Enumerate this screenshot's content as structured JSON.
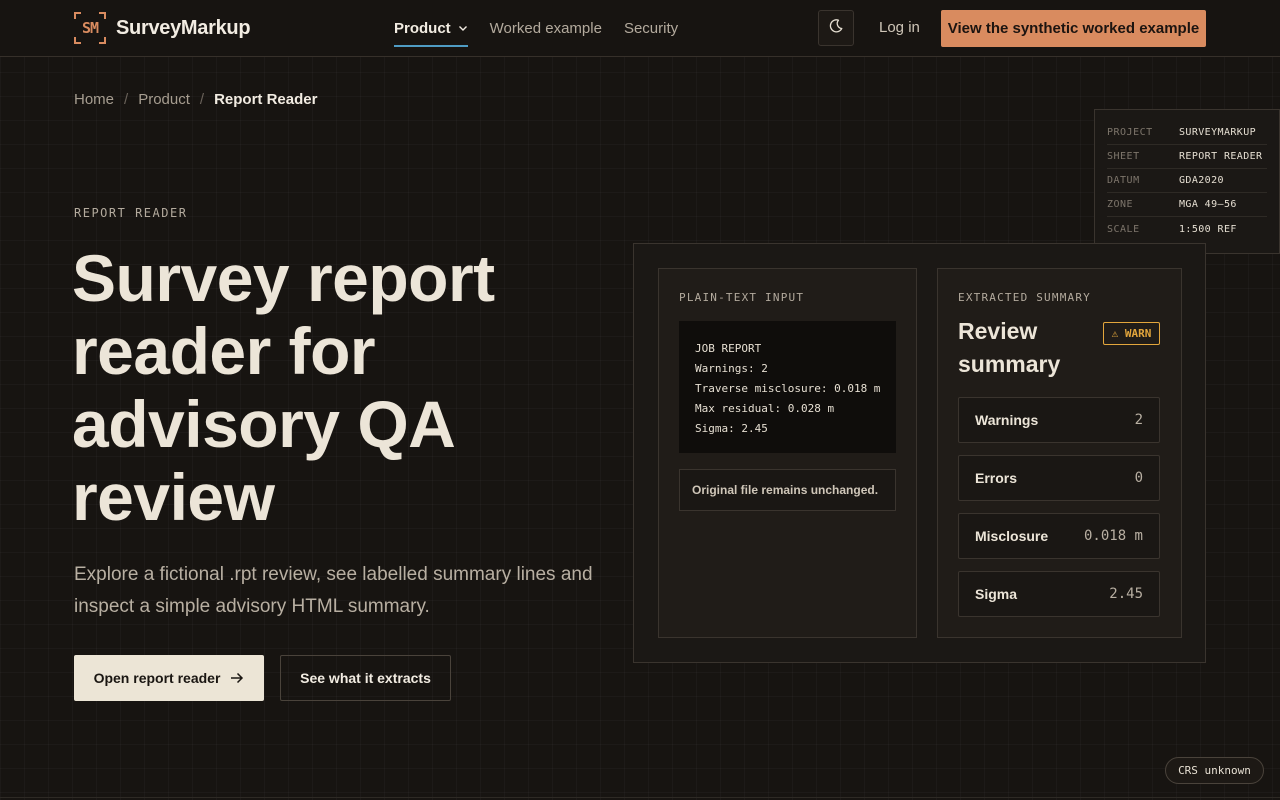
{
  "header": {
    "logo_initials": "SM",
    "brand": "SurveyMarkup",
    "nav": [
      {
        "label": "Product",
        "active": true
      },
      {
        "label": "Worked example",
        "active": false
      },
      {
        "label": "Security",
        "active": false
      }
    ],
    "theme_icon": "moon-icon",
    "login_label": "Log in",
    "cta_label": "View the synthetic worked example"
  },
  "breadcrumb": {
    "items": [
      "Home",
      "Product"
    ],
    "current": "Report Reader",
    "separator": "/"
  },
  "title_block": [
    {
      "key": "PROJECT",
      "value": "SURVEYMARKUP"
    },
    {
      "key": "SHEET",
      "value": "REPORT READER"
    },
    {
      "key": "DATUM",
      "value": "GDA2020"
    },
    {
      "key": "ZONE",
      "value": "MGA 49–56"
    },
    {
      "key": "SCALE",
      "value": "1:500 REF"
    }
  ],
  "hero": {
    "eyebrow": "REPORT READER",
    "title": "Survey report reader for advisory QA review",
    "description": "Explore a fictional .rpt review, see labelled summary lines and inspect a simple advisory HTML summary.",
    "primary_button": "Open report reader",
    "secondary_button": "See what it extracts"
  },
  "demo": {
    "input_label": "PLAIN-TEXT INPUT",
    "input_lines": [
      "JOB REPORT",
      "Warnings: 2",
      "Traverse misclosure: 0.018 m",
      "Max residual: 0.028 m",
      "Sigma: 2.45"
    ],
    "note": "Original file remains unchanged.",
    "summary_label": "EXTRACTED SUMMARY",
    "summary_title": "Review summary",
    "badge": "⚠ WARN",
    "metrics": [
      {
        "label": "Warnings",
        "value": "2"
      },
      {
        "label": "Errors",
        "value": "0"
      },
      {
        "label": "Misclosure",
        "value": "0.018 m"
      },
      {
        "label": "Sigma",
        "value": "2.45"
      }
    ]
  },
  "crs_chip": "CRS unknown",
  "colors": {
    "accent": "#d98b5f",
    "nav_underline": "#4f9cc4",
    "warn": "#e3a63c",
    "background": "#171411"
  }
}
